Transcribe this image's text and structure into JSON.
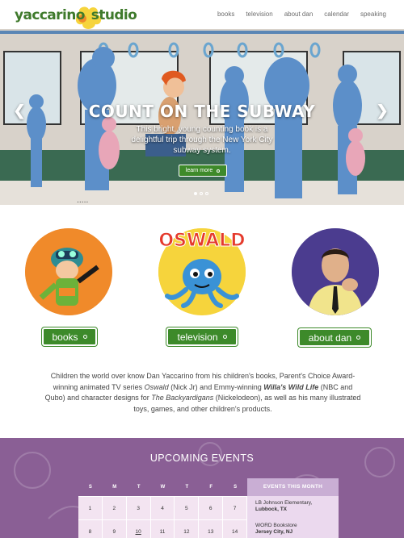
{
  "header": {
    "logo_left": "yaccarino",
    "logo_right": "studio",
    "nav": [
      "books",
      "television",
      "about dan",
      "calendar",
      "speaking"
    ]
  },
  "hero": {
    "title": "COUNT ON THE SUBWAY",
    "description": "This bright, young counting book is a delightful trip through the New York City subway system.",
    "button_label": "learn more",
    "slides": 3,
    "active_slide": 1
  },
  "features": [
    {
      "label": "books",
      "icon": "astronaut-illustration"
    },
    {
      "label": "television",
      "icon": "oswald-octopus-illustration",
      "art_text": "OSWALD"
    },
    {
      "label": "about dan",
      "icon": "dan-portrait-photo"
    }
  ],
  "intro": {
    "p1": "Children the world over know Dan Yaccarino from his children's books, Parent's Choice Award-winning animated TV series ",
    "t1": "Oswald",
    "p2": " (Nick Jr) and Emmy-winning ",
    "t2": "Willa's Wild Life",
    "p3": " (NBC and Qubo) and character designs for ",
    "t3": "The Backyardigans",
    "p4": " (Nickelodeon), as well as his many illustrated toys, games, and other children's products."
  },
  "events": {
    "title": "UPCOMING EVENTS",
    "weekdays": [
      "S",
      "M",
      "T",
      "W",
      "T",
      "F",
      "S"
    ],
    "rows": [
      [
        "1",
        "2",
        "3",
        "4",
        "5",
        "6",
        "7"
      ],
      [
        "8",
        "9",
        "10",
        "11",
        "12",
        "13",
        "14"
      ]
    ],
    "month_header": "EVENTS THIS MONTH",
    "items": [
      {
        "venue": "LB Johnson Elementary,",
        "location": "Lubbock, TX"
      },
      {
        "venue": "WORD Bookstore",
        "location": "Jersey City, NJ"
      }
    ]
  },
  "colors": {
    "brand_green": "#3d8a2a",
    "events_purple": "#8a5f95",
    "logo_yellow": "#f6d43c",
    "logo_orange": "#ef8a2b"
  }
}
